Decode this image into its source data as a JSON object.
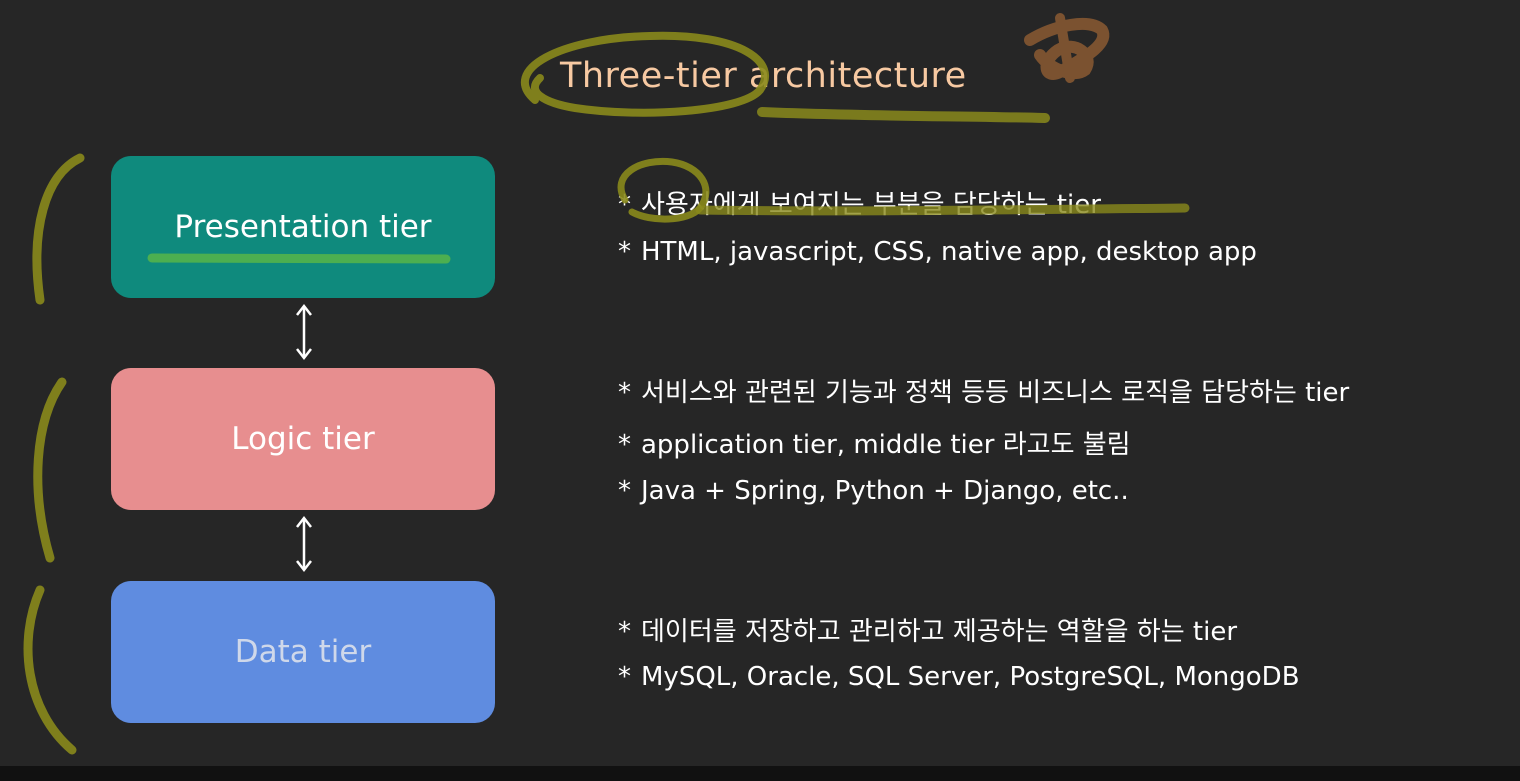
{
  "title": "Three-tier architecture",
  "tiers": [
    {
      "label": "Presentation tier",
      "color": "#0f8a7d",
      "bullets": [
        "사용자에게 보여지는 부분을 담당하는 tier",
        "HTML, javascript, CSS, native app, desktop app"
      ]
    },
    {
      "label": "Logic tier",
      "color": "#e78e8f",
      "bullets": [
        "서비스와 관련된 기능과 정책 등등 비즈니스 로직을 담당하는 tier",
        "application tier, middle tier 라고도 불림",
        "Java + Spring, Python + Django, etc.."
      ]
    },
    {
      "label": "Data tier",
      "color": "#5f8ce0",
      "bullets": [
        "데이터를 저장하고 관리하고 제공하는 역할을 하는 tier",
        "MySQL, Oracle, SQL Server, PostgreSQL, MongoDB"
      ]
    }
  ],
  "bullet_marker": "*",
  "arrow_icon": "double-arrow-vertical",
  "annotation_colors": {
    "highlighter": "#8a8a1c",
    "underline_green": "#4caf50",
    "scribble": "#8a5a32"
  }
}
